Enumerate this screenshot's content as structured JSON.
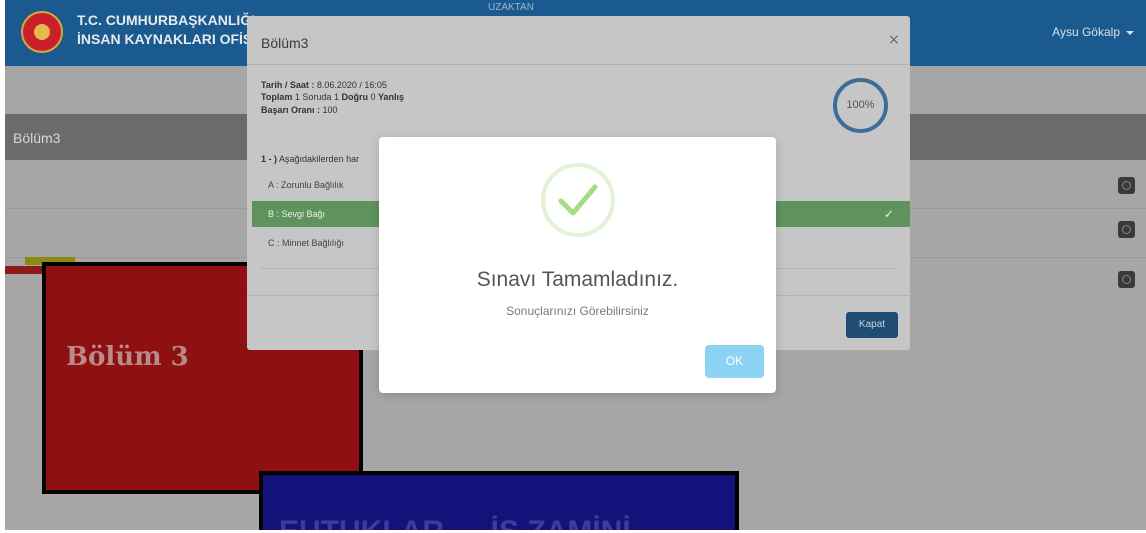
{
  "app": {
    "org_name_line1": "T.C. CUMHURBAŞKANLIĞI",
    "org_name_line2": "İNSAN KAYNAKLARI OFİSİ",
    "nav_fragment": "UZAKTAN",
    "user_name": "Aysu Gökalp",
    "accent_color": "#1b5a8e"
  },
  "sidebar": {
    "section_title": "Bölüm3"
  },
  "slides": {
    "red_card_title": "Bölüm 3",
    "blue_card_title": "EUTUKLAR … İŞ ZAMİNİ"
  },
  "result_modal": {
    "title": "Bölüm3",
    "close_glyph": "×",
    "date_label": "Tarih / Saat :",
    "date_value": "8.06.2020 / 16:05",
    "total_label": "Toplam",
    "total_value": "1",
    "question_word": "Soruda",
    "correct_value": "1",
    "correct_label": "Doğru",
    "wrong_value": "0",
    "wrong_label": "Yanlış",
    "success_rate_label": "Başarı Oranı :",
    "success_rate_value": "100",
    "score_percent": "100%",
    "question_number": "1 - )",
    "question_text": "Aşağıdakilerden har",
    "answers": [
      {
        "label": "A : Zorunlu Bağlılık"
      },
      {
        "label": "B : Sevgi Bağı"
      },
      {
        "label": "C : Minnet Bağlılığı"
      }
    ],
    "correct_answer_mark": "✓",
    "close_button_label": "Kapat"
  },
  "alert": {
    "title": "Sınavı Tamamladınız.",
    "text": "Sonuçlarınızı Görebilirsiniz",
    "ok_label": "OK",
    "icon": "success-check-icon",
    "check_color": "#a5dc86"
  }
}
